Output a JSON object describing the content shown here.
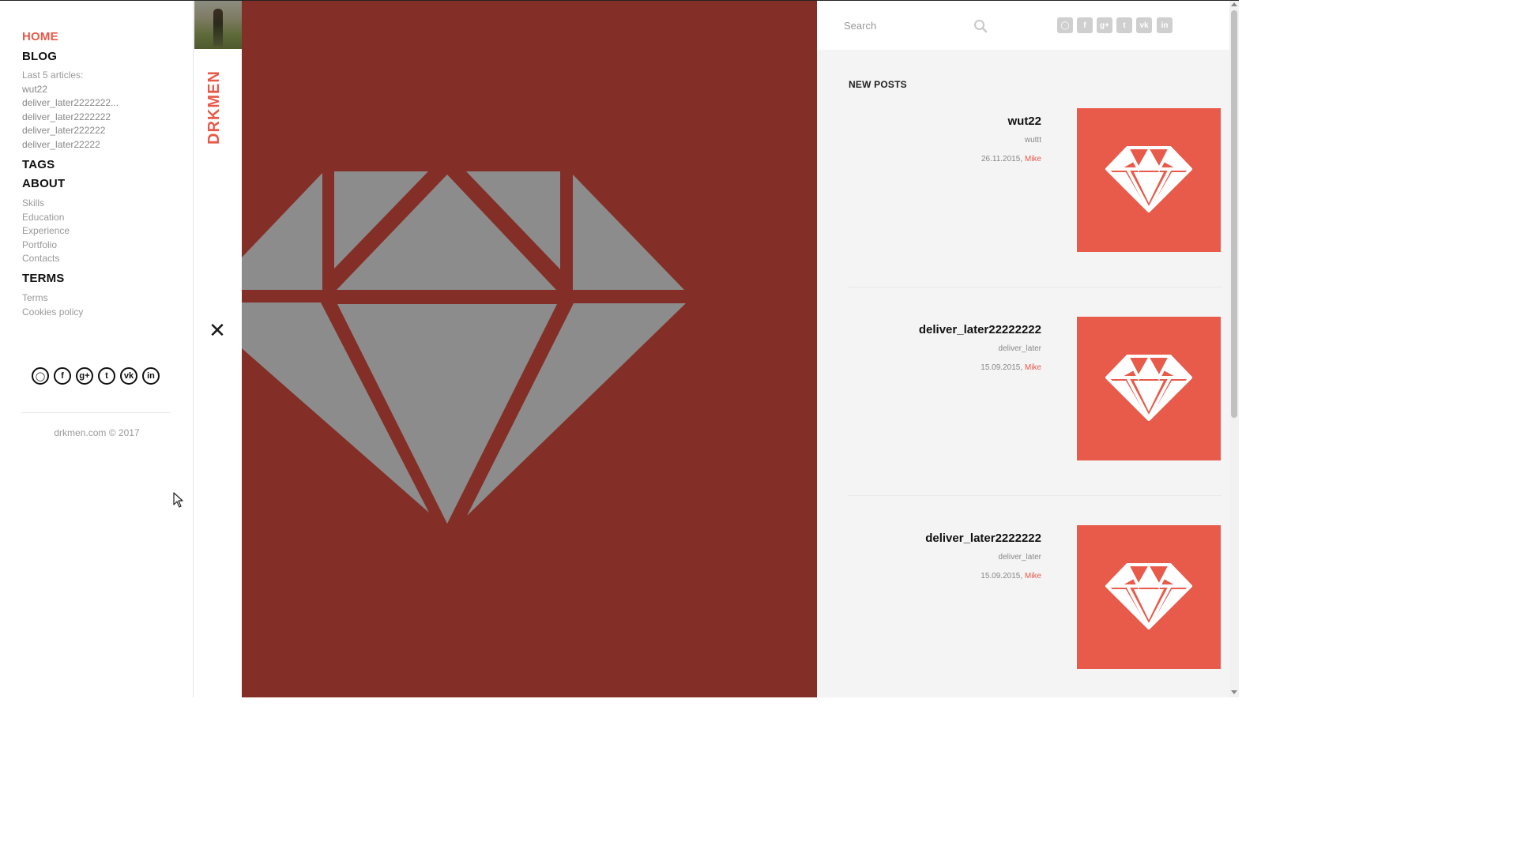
{
  "nav": {
    "home": "HOME",
    "blog": "BLOG",
    "last_articles_label": "Last 5 articles:",
    "articles": [
      "wut22",
      "deliver_later2222222...",
      "deliver_later2222222",
      "deliver_later222222",
      "deliver_later22222"
    ],
    "tags": "TAGS",
    "about": "ABOUT",
    "about_items": [
      "Skills",
      "Education",
      "Experience",
      "Portfolio",
      "Contacts"
    ],
    "terms": "TERMS",
    "terms_items": [
      "Terms",
      "Cookies policy"
    ]
  },
  "social_icons": [
    "github-icon",
    "facebook-icon",
    "google-plus-icon",
    "twitter-icon",
    "vk-icon",
    "linkedin-icon"
  ],
  "social_glyphs": [
    "◯",
    "f",
    "g+",
    "t",
    "vk",
    "in"
  ],
  "footer": {
    "copyright": "drkmen.com © 2017"
  },
  "brand": {
    "name": "DRKMEN",
    "close_glyph": "✕"
  },
  "search": {
    "placeholder": "Search",
    "value": ""
  },
  "new_posts": {
    "title": "NEW POSTS",
    "posts": [
      {
        "title": "wut22",
        "excerpt": "wuttt",
        "date": "26.11.2015,",
        "author": "Mike"
      },
      {
        "title": "deliver_later22222222",
        "excerpt": "deliver_later",
        "date": "15.09.2015,",
        "author": "Mike"
      },
      {
        "title": "deliver_later2222222",
        "excerpt": "deliver_later",
        "date": "15.09.2015,",
        "author": "Mike"
      }
    ]
  },
  "colors": {
    "accent": "#e8594a",
    "hero_bg": "#832f27",
    "hero_gem": "#8c8c8c",
    "thumb_bg": "#e85a4a",
    "panel_bg": "#f4f4f4"
  }
}
